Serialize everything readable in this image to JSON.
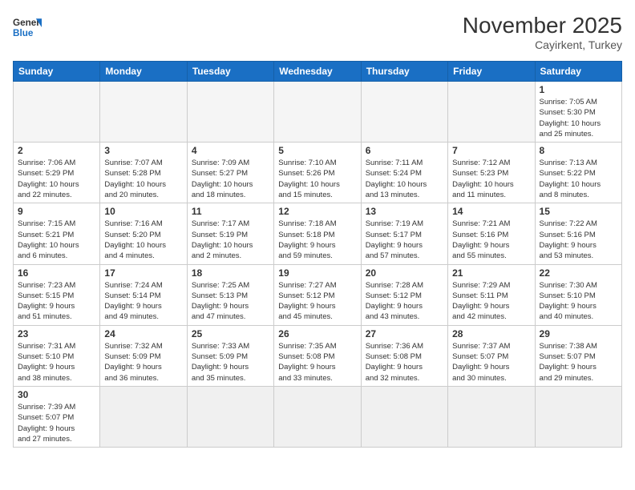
{
  "header": {
    "logo_general": "General",
    "logo_blue": "Blue",
    "month_title": "November 2025",
    "subtitle": "Cayirkent, Turkey"
  },
  "weekdays": [
    "Sunday",
    "Monday",
    "Tuesday",
    "Wednesday",
    "Thursday",
    "Friday",
    "Saturday"
  ],
  "weeks": [
    [
      {
        "day": "",
        "info": "",
        "empty": true
      },
      {
        "day": "",
        "info": "",
        "empty": true
      },
      {
        "day": "",
        "info": "",
        "empty": true
      },
      {
        "day": "",
        "info": "",
        "empty": true
      },
      {
        "day": "",
        "info": "",
        "empty": true
      },
      {
        "day": "",
        "info": "",
        "empty": true
      },
      {
        "day": "1",
        "info": "Sunrise: 7:05 AM\nSunset: 5:30 PM\nDaylight: 10 hours\nand 25 minutes."
      }
    ],
    [
      {
        "day": "2",
        "info": "Sunrise: 7:06 AM\nSunset: 5:29 PM\nDaylight: 10 hours\nand 22 minutes."
      },
      {
        "day": "3",
        "info": "Sunrise: 7:07 AM\nSunset: 5:28 PM\nDaylight: 10 hours\nand 20 minutes."
      },
      {
        "day": "4",
        "info": "Sunrise: 7:09 AM\nSunset: 5:27 PM\nDaylight: 10 hours\nand 18 minutes."
      },
      {
        "day": "5",
        "info": "Sunrise: 7:10 AM\nSunset: 5:26 PM\nDaylight: 10 hours\nand 15 minutes."
      },
      {
        "day": "6",
        "info": "Sunrise: 7:11 AM\nSunset: 5:24 PM\nDaylight: 10 hours\nand 13 minutes."
      },
      {
        "day": "7",
        "info": "Sunrise: 7:12 AM\nSunset: 5:23 PM\nDaylight: 10 hours\nand 11 minutes."
      },
      {
        "day": "8",
        "info": "Sunrise: 7:13 AM\nSunset: 5:22 PM\nDaylight: 10 hours\nand 8 minutes."
      }
    ],
    [
      {
        "day": "9",
        "info": "Sunrise: 7:15 AM\nSunset: 5:21 PM\nDaylight: 10 hours\nand 6 minutes."
      },
      {
        "day": "10",
        "info": "Sunrise: 7:16 AM\nSunset: 5:20 PM\nDaylight: 10 hours\nand 4 minutes."
      },
      {
        "day": "11",
        "info": "Sunrise: 7:17 AM\nSunset: 5:19 PM\nDaylight: 10 hours\nand 2 minutes."
      },
      {
        "day": "12",
        "info": "Sunrise: 7:18 AM\nSunset: 5:18 PM\nDaylight: 9 hours\nand 59 minutes."
      },
      {
        "day": "13",
        "info": "Sunrise: 7:19 AM\nSunset: 5:17 PM\nDaylight: 9 hours\nand 57 minutes."
      },
      {
        "day": "14",
        "info": "Sunrise: 7:21 AM\nSunset: 5:16 PM\nDaylight: 9 hours\nand 55 minutes."
      },
      {
        "day": "15",
        "info": "Sunrise: 7:22 AM\nSunset: 5:16 PM\nDaylight: 9 hours\nand 53 minutes."
      }
    ],
    [
      {
        "day": "16",
        "info": "Sunrise: 7:23 AM\nSunset: 5:15 PM\nDaylight: 9 hours\nand 51 minutes."
      },
      {
        "day": "17",
        "info": "Sunrise: 7:24 AM\nSunset: 5:14 PM\nDaylight: 9 hours\nand 49 minutes."
      },
      {
        "day": "18",
        "info": "Sunrise: 7:25 AM\nSunset: 5:13 PM\nDaylight: 9 hours\nand 47 minutes."
      },
      {
        "day": "19",
        "info": "Sunrise: 7:27 AM\nSunset: 5:12 PM\nDaylight: 9 hours\nand 45 minutes."
      },
      {
        "day": "20",
        "info": "Sunrise: 7:28 AM\nSunset: 5:12 PM\nDaylight: 9 hours\nand 43 minutes."
      },
      {
        "day": "21",
        "info": "Sunrise: 7:29 AM\nSunset: 5:11 PM\nDaylight: 9 hours\nand 42 minutes."
      },
      {
        "day": "22",
        "info": "Sunrise: 7:30 AM\nSunset: 5:10 PM\nDaylight: 9 hours\nand 40 minutes."
      }
    ],
    [
      {
        "day": "23",
        "info": "Sunrise: 7:31 AM\nSunset: 5:10 PM\nDaylight: 9 hours\nand 38 minutes."
      },
      {
        "day": "24",
        "info": "Sunrise: 7:32 AM\nSunset: 5:09 PM\nDaylight: 9 hours\nand 36 minutes."
      },
      {
        "day": "25",
        "info": "Sunrise: 7:33 AM\nSunset: 5:09 PM\nDaylight: 9 hours\nand 35 minutes."
      },
      {
        "day": "26",
        "info": "Sunrise: 7:35 AM\nSunset: 5:08 PM\nDaylight: 9 hours\nand 33 minutes."
      },
      {
        "day": "27",
        "info": "Sunrise: 7:36 AM\nSunset: 5:08 PM\nDaylight: 9 hours\nand 32 minutes."
      },
      {
        "day": "28",
        "info": "Sunrise: 7:37 AM\nSunset: 5:07 PM\nDaylight: 9 hours\nand 30 minutes."
      },
      {
        "day": "29",
        "info": "Sunrise: 7:38 AM\nSunset: 5:07 PM\nDaylight: 9 hours\nand 29 minutes."
      }
    ],
    [
      {
        "day": "30",
        "info": "Sunrise: 7:39 AM\nSunset: 5:07 PM\nDaylight: 9 hours\nand 27 minutes."
      },
      {
        "day": "",
        "info": "",
        "empty": true
      },
      {
        "day": "",
        "info": "",
        "empty": true
      },
      {
        "day": "",
        "info": "",
        "empty": true
      },
      {
        "day": "",
        "info": "",
        "empty": true
      },
      {
        "day": "",
        "info": "",
        "empty": true
      },
      {
        "day": "",
        "info": "",
        "empty": true
      }
    ]
  ]
}
